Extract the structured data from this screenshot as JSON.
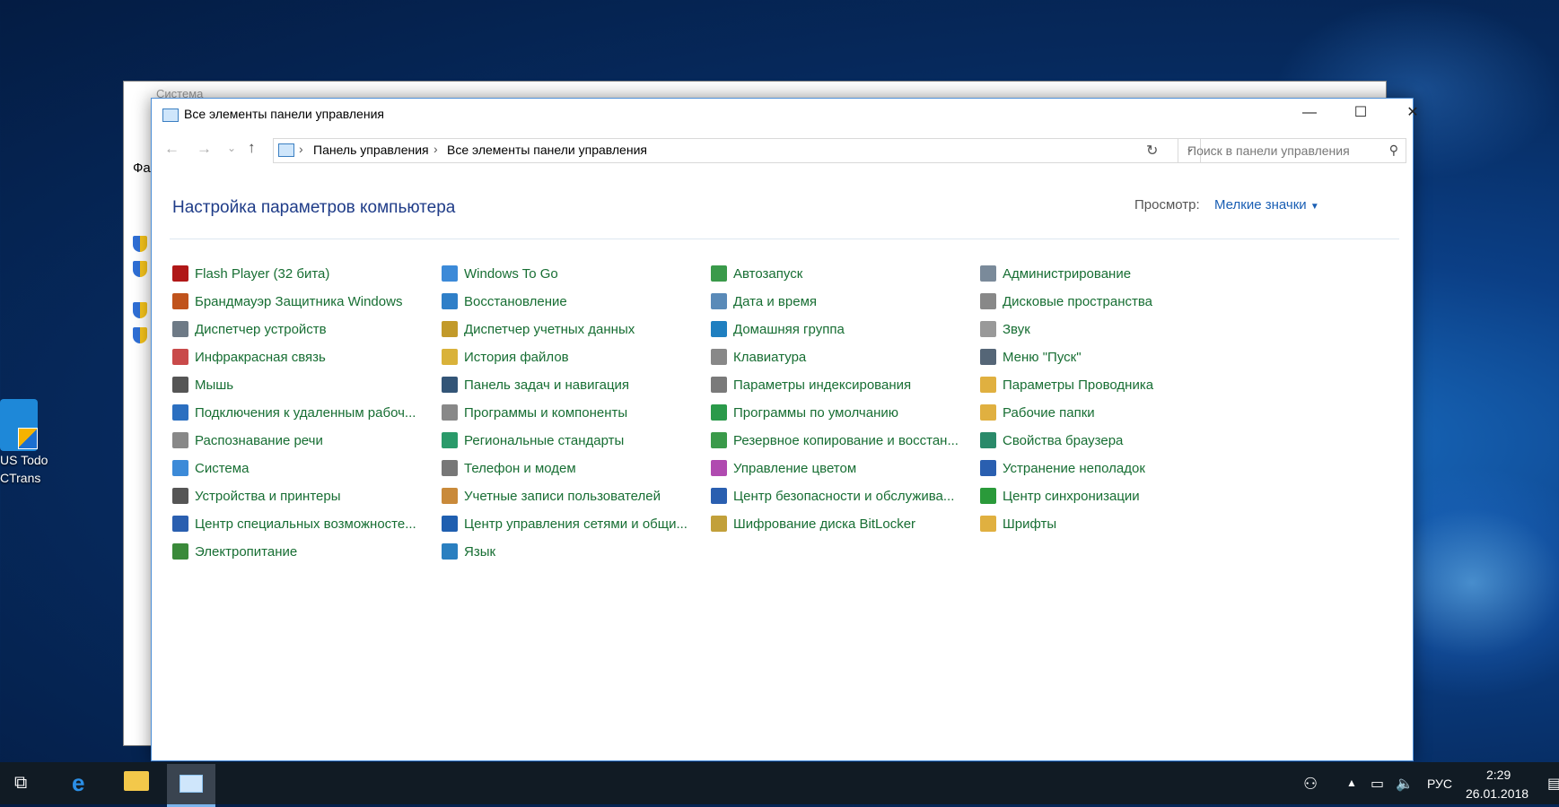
{
  "desktop": {
    "icon_label_line1": "US Todo",
    "icon_label_line2": "CTrans"
  },
  "background_window": {
    "title": "Система",
    "menu_fragment": "Фа"
  },
  "window": {
    "title": "Все элементы панели управления",
    "controls": {
      "minimize": "—",
      "maximize": "☐",
      "close": "✕"
    },
    "address": {
      "crumb1": "Панель управления",
      "crumb2": "Все элементы панели управления"
    },
    "search_placeholder": "Поиск в панели управления",
    "heading": "Настройка параметров компьютера",
    "view_label": "Просмотр:",
    "view_value": "Мелкие значки"
  },
  "items": {
    "col1": [
      {
        "label": "Flash Player (32 бита)",
        "icon": "flash-icon",
        "color": "#b01818"
      },
      {
        "label": "Брандмауэр Защитника Windows",
        "icon": "firewall-icon",
        "color": "#c0531c"
      },
      {
        "label": "Диспетчер устройств",
        "icon": "device-manager-icon",
        "color": "#6e7a86"
      },
      {
        "label": "Инфракрасная связь",
        "icon": "infrared-icon",
        "color": "#c94a4a"
      },
      {
        "label": "Мышь",
        "icon": "mouse-icon",
        "color": "#555555"
      },
      {
        "label": "Подключения к удаленным рабоч...",
        "icon": "remote-icon",
        "color": "#2b6fc0"
      },
      {
        "label": "Распознавание речи",
        "icon": "microphone-icon",
        "color": "#888888"
      },
      {
        "label": "Система",
        "icon": "system-icon",
        "color": "#3c8ad8"
      },
      {
        "label": "Устройства и принтеры",
        "icon": "printer-icon",
        "color": "#555555"
      },
      {
        "label": "Центр специальных возможносте...",
        "icon": "accessibility-icon",
        "color": "#2a5fb0"
      },
      {
        "label": "Электропитание",
        "icon": "power-icon",
        "color": "#3a8a3a"
      }
    ],
    "col2": [
      {
        "label": "Windows To Go",
        "icon": "windows-to-go-icon",
        "color": "#3c8ad8"
      },
      {
        "label": "Восстановление",
        "icon": "recovery-icon",
        "color": "#2f7fc8"
      },
      {
        "label": "Диспетчер учетных данных",
        "icon": "credentials-icon",
        "color": "#c29a2a"
      },
      {
        "label": "История файлов",
        "icon": "file-history-icon",
        "color": "#d9b23a"
      },
      {
        "label": "Панель задач и навигация",
        "icon": "taskbar-icon",
        "color": "#335577"
      },
      {
        "label": "Программы и компоненты",
        "icon": "programs-icon",
        "color": "#888888"
      },
      {
        "label": "Региональные стандарты",
        "icon": "region-icon",
        "color": "#2a9a6a"
      },
      {
        "label": "Телефон и модем",
        "icon": "phone-icon",
        "color": "#777777"
      },
      {
        "label": "Учетные записи пользователей",
        "icon": "users-icon",
        "color": "#c98a3a"
      },
      {
        "label": "Центр управления сетями и общи...",
        "icon": "network-icon",
        "color": "#1f5fb0"
      },
      {
        "label": "Язык",
        "icon": "language-icon",
        "color": "#2a7fc0"
      }
    ],
    "col3": [
      {
        "label": "Автозапуск",
        "icon": "autoplay-icon",
        "color": "#3a9a4a"
      },
      {
        "label": "Дата и время",
        "icon": "datetime-icon",
        "color": "#5a8ab8"
      },
      {
        "label": "Домашняя группа",
        "icon": "homegroup-icon",
        "color": "#1f7fc0"
      },
      {
        "label": "Клавиатура",
        "icon": "keyboard-icon",
        "color": "#888888"
      },
      {
        "label": "Параметры индексирования",
        "icon": "indexing-icon",
        "color": "#7a7a7a"
      },
      {
        "label": "Программы по умолчанию",
        "icon": "default-programs-icon",
        "color": "#2a9a4a"
      },
      {
        "label": "Резервное копирование и восстан...",
        "icon": "backup-icon",
        "color": "#3a9a4a"
      },
      {
        "label": "Управление цветом",
        "icon": "color-icon",
        "color": "#b04ab0"
      },
      {
        "label": "Центр безопасности и обслужива...",
        "icon": "security-flag-icon",
        "color": "#2a5fb0"
      },
      {
        "label": "Шифрование диска BitLocker",
        "icon": "bitlocker-icon",
        "color": "#c2a03a"
      }
    ],
    "col4": [
      {
        "label": "Администрирование",
        "icon": "admin-icon",
        "color": "#7a8a9a"
      },
      {
        "label": "Дисковые пространства",
        "icon": "storage-icon",
        "color": "#888888"
      },
      {
        "label": "Звук",
        "icon": "sound-icon",
        "color": "#999999"
      },
      {
        "label": "Меню \"Пуск\"",
        "icon": "start-menu-icon",
        "color": "#556677"
      },
      {
        "label": "Параметры Проводника",
        "icon": "explorer-options-icon",
        "color": "#e0b040"
      },
      {
        "label": "Рабочие папки",
        "icon": "work-folders-icon",
        "color": "#e0b040"
      },
      {
        "label": "Свойства браузера",
        "icon": "browser-icon",
        "color": "#2a8a6a"
      },
      {
        "label": "Устранение неполадок",
        "icon": "troubleshoot-icon",
        "color": "#2a5fb0"
      },
      {
        "label": "Центр синхронизации",
        "icon": "sync-icon",
        "color": "#2a9a3a"
      },
      {
        "label": "Шрифты",
        "icon": "fonts-icon",
        "color": "#e0b040"
      }
    ]
  },
  "tray": {
    "language": "РУС",
    "time": "2:29",
    "date": "26.01.2018"
  }
}
